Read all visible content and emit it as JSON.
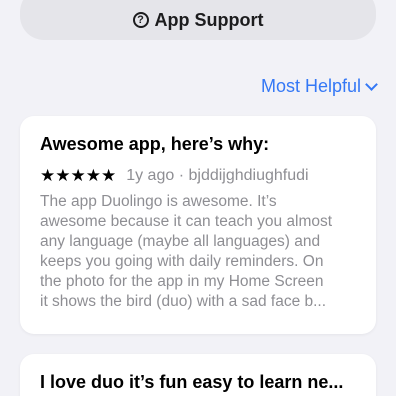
{
  "support": {
    "icon": "question-circle-icon",
    "label": "App Support"
  },
  "sort": {
    "label": "Most Helpful",
    "icon": "chevron-down-icon"
  },
  "reviews": [
    {
      "title": "Awesome app, here’s why:",
      "stars": "★★★★★",
      "rating": 5,
      "age": "1y ago",
      "separator": "·",
      "author": "bjddijghdiughfudi",
      "body_lines": [
        "The app Duolingo is awesome. It’s",
        "awesome because it can teach you almost",
        "any language (maybe all languages) and",
        "keeps you going with daily reminders. On",
        "the photo for the app in my Home Screen",
        "it shows the bird (duo) with a sad face b..."
      ]
    },
    {
      "title": "I love duo it’s fun easy to learn ne..."
    }
  ]
}
